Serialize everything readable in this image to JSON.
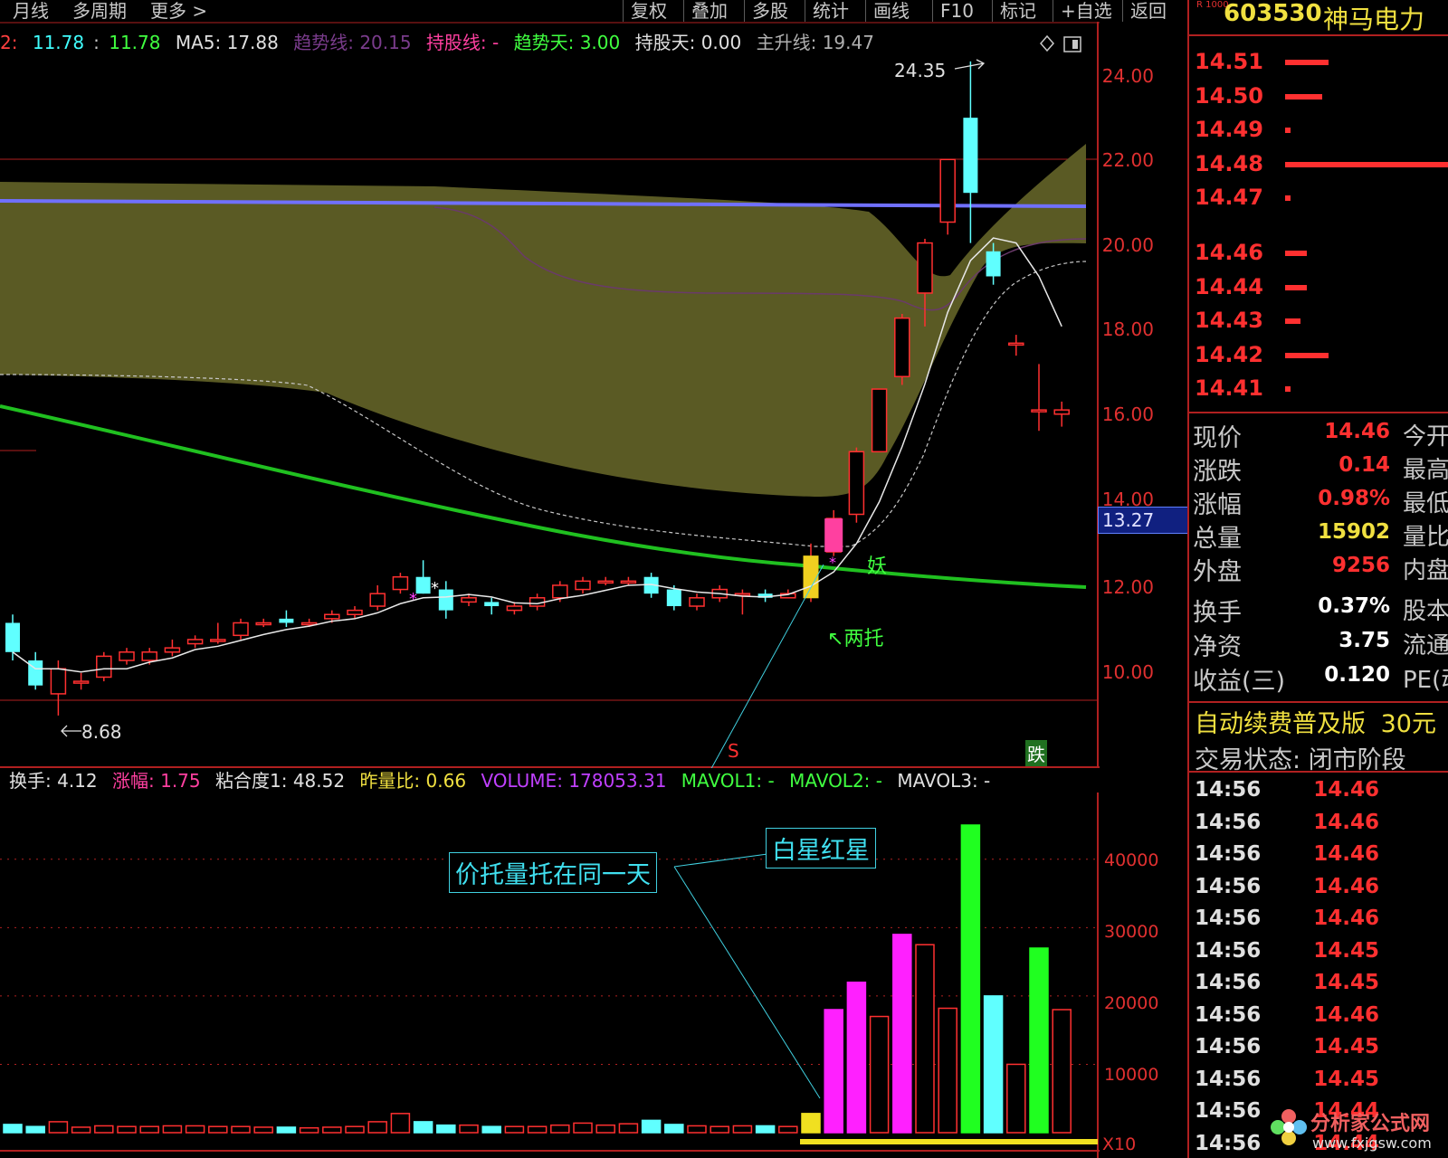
{
  "toolbar": {
    "left_items": [
      "月线",
      "多周期",
      "更多 >"
    ],
    "buttons": [
      "复权",
      "叠加",
      "多股",
      "统计",
      "画线",
      "F10",
      "标记",
      "+自选",
      "返回"
    ]
  },
  "main_info": {
    "prefix": "2",
    "val1": "11.78",
    "val2": "11.78",
    "ma5": "MA5: 17.88",
    "trend_line": "趋势线: 20.15",
    "hold_line": "持股线: -",
    "trend_days": "趋势天: 3.00",
    "hold_days": "持股天: 0.00",
    "main_rise": "主升线: 19.47"
  },
  "price_axis": [
    "24.00",
    "22.00",
    "20.00",
    "18.00",
    "16.00",
    "14.00",
    "12.00",
    "10.00"
  ],
  "current_price_tag": "13.27",
  "price_annotations": {
    "high": "24.35",
    "low": "8.68",
    "yao": "妖",
    "liangtuo": "两托",
    "s_marker": "S",
    "die_marker": "跌"
  },
  "vol_info": {
    "turnover": "换手: 4.12",
    "change": "涨幅: 1.75",
    "cohesion": "粘合度1: 48.52",
    "vol_ratio": "昨量比: 0.66",
    "volume": "VOLUME: 178053.31",
    "mavol1": "MAVOL1: -",
    "mavol2": "MAVOL2: -",
    "mavol3": "MAVOL3: -"
  },
  "vol_axis": [
    "40000",
    "30000",
    "20000",
    "10000"
  ],
  "vol_unit": "X10",
  "annotations": {
    "box1": "价托量托在同一天",
    "box2": "白星红星"
  },
  "stock": {
    "code": "603530",
    "name": "神马电力",
    "corner": "R 1000"
  },
  "order_book": [
    {
      "price": "14.51",
      "bar": 0.2
    },
    {
      "price": "14.50",
      "bar": 0.17
    },
    {
      "price": "14.49",
      "bar": 0.02
    },
    {
      "price": "14.48",
      "bar": 0.75
    },
    {
      "price": "14.47",
      "bar": 0.02
    },
    {
      "price": "14.46",
      "bar": 0.1
    },
    {
      "price": "14.44",
      "bar": 0.1
    },
    {
      "price": "14.43",
      "bar": 0.07
    },
    {
      "price": "14.42",
      "bar": 0.2
    },
    {
      "price": "14.41",
      "bar": 0.02
    }
  ],
  "quote": [
    {
      "label": "现价",
      "value": "14.46",
      "color": "#ff3030",
      "extra": "今开"
    },
    {
      "label": "涨跌",
      "value": "0.14",
      "color": "#ff3030",
      "extra": "最高"
    },
    {
      "label": "涨幅",
      "value": "0.98%",
      "color": "#ff3030",
      "extra": "最低"
    },
    {
      "label": "总量",
      "value": "15902",
      "color": "#f0e040",
      "extra": "量比"
    },
    {
      "label": "外盘",
      "value": "9256",
      "color": "#ff3030",
      "extra": "内盘"
    },
    {
      "label": "换手",
      "value": "0.37%",
      "color": "#ffffff",
      "extra": "股本"
    },
    {
      "label": "净资",
      "value": "3.75",
      "color": "#ffffff",
      "extra": "流通"
    },
    {
      "label": "收益(三)",
      "value": "0.120",
      "color": "#ffffff",
      "extra": "PE(动)"
    }
  ],
  "banner": {
    "text": "自动续费普及版",
    "price": "30元"
  },
  "trade_status": "交易状态: 闭市阶段",
  "ticks": [
    {
      "time": "14:56",
      "price": "14.46"
    },
    {
      "time": "14:56",
      "price": "14.46"
    },
    {
      "time": "14:56",
      "price": "14.46"
    },
    {
      "time": "14:56",
      "price": "14.46"
    },
    {
      "time": "14:56",
      "price": "14.46"
    },
    {
      "time": "14:56",
      "price": "14.45"
    },
    {
      "time": "14:56",
      "price": "14.45"
    },
    {
      "time": "14:56",
      "price": "14.46"
    },
    {
      "time": "14:56",
      "price": "14.45"
    },
    {
      "time": "14:56",
      "price": "14.45"
    },
    {
      "time": "14:56",
      "price": "14.44"
    },
    {
      "time": "14:56",
      "price": "14.44"
    }
  ],
  "watermark": {
    "text": "分析家公式网",
    "url": "www.fxjgsw.com"
  },
  "colors": {
    "up": "#ff3030",
    "down": "#60ffff",
    "band": "#5a5a24",
    "trend": "#7070ff",
    "ma_long": "#20c020",
    "bg": "#000000"
  },
  "chart_data": {
    "type": "candlestick",
    "ylim": [
      8.0,
      25.0
    ],
    "candles": [
      {
        "o": 10.9,
        "c": 10.2,
        "h": 11.1,
        "l": 10.0
      },
      {
        "o": 10.0,
        "c": 9.4,
        "h": 10.2,
        "l": 9.3
      },
      {
        "o": 9.2,
        "c": 9.8,
        "h": 10.0,
        "l": 8.68
      },
      {
        "o": 9.5,
        "c": 9.5,
        "h": 9.7,
        "l": 9.3
      },
      {
        "o": 9.6,
        "c": 10.1,
        "h": 10.2,
        "l": 9.5
      },
      {
        "o": 10.0,
        "c": 10.2,
        "h": 10.3,
        "l": 9.9
      },
      {
        "o": 10.0,
        "c": 10.2,
        "h": 10.3,
        "l": 9.9
      },
      {
        "o": 10.2,
        "c": 10.3,
        "h": 10.5,
        "l": 10.1
      },
      {
        "o": 10.4,
        "c": 10.5,
        "h": 10.6,
        "l": 10.3
      },
      {
        "o": 10.5,
        "c": 10.5,
        "h": 10.9,
        "l": 10.4
      },
      {
        "o": 10.6,
        "c": 10.9,
        "h": 11.0,
        "l": 10.5
      },
      {
        "o": 10.9,
        "c": 10.9,
        "h": 11.0,
        "l": 10.8
      },
      {
        "o": 11.0,
        "c": 10.9,
        "h": 11.2,
        "l": 10.8
      },
      {
        "o": 10.9,
        "c": 10.9,
        "h": 11.0,
        "l": 10.8
      },
      {
        "o": 11.0,
        "c": 11.1,
        "h": 11.2,
        "l": 10.9
      },
      {
        "o": 11.1,
        "c": 11.2,
        "h": 11.3,
        "l": 11.0
      },
      {
        "o": 11.3,
        "c": 11.6,
        "h": 11.8,
        "l": 11.2
      },
      {
        "o": 11.7,
        "c": 12.0,
        "h": 12.1,
        "l": 11.6
      },
      {
        "o": 12.0,
        "c": 11.6,
        "h": 12.4,
        "l": 11.6
      },
      {
        "o": 11.7,
        "c": 11.2,
        "h": 11.9,
        "l": 11.0
      },
      {
        "o": 11.4,
        "c": 11.5,
        "h": 11.6,
        "l": 11.3
      },
      {
        "o": 11.4,
        "c": 11.3,
        "h": 11.5,
        "l": 11.1
      },
      {
        "o": 11.2,
        "c": 11.3,
        "h": 11.4,
        "l": 11.1
      },
      {
        "o": 11.3,
        "c": 11.5,
        "h": 11.6,
        "l": 11.2
      },
      {
        "o": 11.5,
        "c": 11.8,
        "h": 11.9,
        "l": 11.4
      },
      {
        "o": 11.7,
        "c": 11.9,
        "h": 12.0,
        "l": 11.6
      },
      {
        "o": 11.9,
        "c": 11.9,
        "h": 12.0,
        "l": 11.8
      },
      {
        "o": 11.9,
        "c": 11.9,
        "h": 12.0,
        "l": 11.8
      },
      {
        "o": 12.0,
        "c": 11.6,
        "h": 12.1,
        "l": 11.5
      },
      {
        "o": 11.7,
        "c": 11.3,
        "h": 11.8,
        "l": 11.2
      },
      {
        "o": 11.3,
        "c": 11.5,
        "h": 11.6,
        "l": 11.2
      },
      {
        "o": 11.5,
        "c": 11.7,
        "h": 11.8,
        "l": 11.4
      },
      {
        "o": 11.6,
        "c": 11.6,
        "h": 11.7,
        "l": 11.1
      },
      {
        "o": 11.6,
        "c": 11.5,
        "h": 11.7,
        "l": 11.4
      },
      {
        "o": 11.5,
        "c": 11.6,
        "h": 11.7,
        "l": 11.5
      },
      {
        "o": 11.5,
        "c": 12.5,
        "h": 12.8,
        "l": 11.4
      },
      {
        "o": 12.6,
        "c": 13.4,
        "h": 13.6,
        "l": 12.5
      },
      {
        "o": 13.5,
        "c": 15.0,
        "h": 15.1,
        "l": 13.3
      },
      {
        "o": 15.0,
        "c": 16.5,
        "h": 16.5,
        "l": 15.0
      },
      {
        "o": 16.8,
        "c": 18.2,
        "h": 18.3,
        "l": 16.6
      },
      {
        "o": 18.8,
        "c": 20.0,
        "h": 20.1,
        "l": 18.0
      },
      {
        "o": 20.5,
        "c": 22.0,
        "h": 22.0,
        "l": 20.2
      },
      {
        "o": 23.0,
        "c": 21.2,
        "h": 24.35,
        "l": 20.0
      },
      {
        "o": 19.8,
        "c": 19.2,
        "h": 20.0,
        "l": 19.0
      },
      {
        "o": 17.6,
        "c": 17.6,
        "h": 17.8,
        "l": 17.3
      },
      {
        "o": 16.0,
        "c": 16.0,
        "h": 17.1,
        "l": 15.5
      },
      {
        "o": 15.9,
        "c": 16.0,
        "h": 16.2,
        "l": 15.6
      }
    ],
    "volumes": [
      1200,
      900,
      1600,
      800,
      1000,
      900,
      900,
      1000,
      1000,
      900,
      900,
      800,
      800,
      700,
      800,
      900,
      1600,
      2800,
      1600,
      1100,
      1100,
      900,
      900,
      900,
      1100,
      1400,
      1100,
      1300,
      1800,
      1200,
      1000,
      900,
      1000,
      1000,
      900,
      2800,
      18000,
      22000,
      17000,
      29000,
      27500,
      18200,
      45000,
      20000,
      10000,
      27000,
      18000
    ],
    "vol_ylim": [
      0,
      50000
    ]
  }
}
